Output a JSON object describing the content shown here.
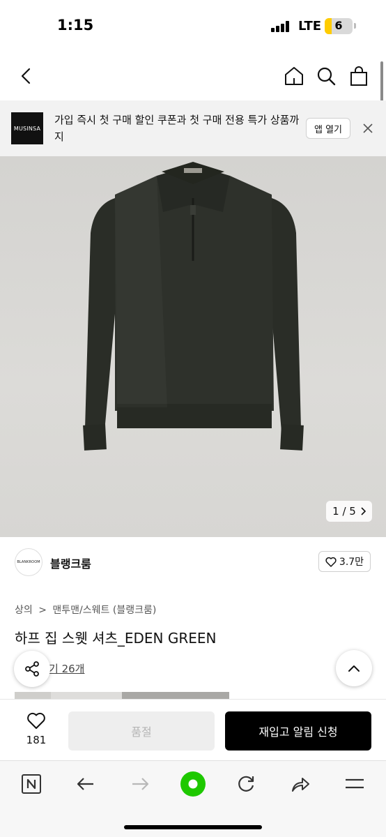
{
  "status_bar": {
    "time": "1:15",
    "network": "LTE",
    "battery": "6"
  },
  "nav": {
    "back_icon": "chevron-left-icon",
    "home_icon": "home-icon",
    "search_icon": "search-icon",
    "bag_icon": "shopping-bag-icon"
  },
  "banner": {
    "logo": "MUSINSA",
    "text": "가입 즉시 첫 구매 할인 쿠폰과 첫 구매 전용 특가 상품까지",
    "open_label": "앱 열기",
    "close_icon": "close-icon"
  },
  "gallery": {
    "counter": "1 / 5"
  },
  "brand": {
    "logo_text": "BLANKROOM",
    "name": "블랭크룸",
    "likes": "3.7만"
  },
  "breadcrumb": [
    "상의",
    "맨투맨/스웨트 (블랭크룸)"
  ],
  "product": {
    "title": "하프 집 스웻 셔츠_EDEN GREEN",
    "review": "기 26개"
  },
  "purchase": {
    "wish_count": "181",
    "soldout_label": "품절",
    "restock_label": "재입고 알림 신청"
  },
  "browser": {
    "icons": [
      "naver-n-icon",
      "back-arrow-icon",
      "forward-arrow-icon",
      "green-dot-icon",
      "refresh-icon",
      "share-arrow-icon",
      "menu-icon"
    ]
  },
  "colors": {
    "accent_green": "#1ec800",
    "garment": "#2c2f29",
    "background": "#d8d7d4"
  }
}
